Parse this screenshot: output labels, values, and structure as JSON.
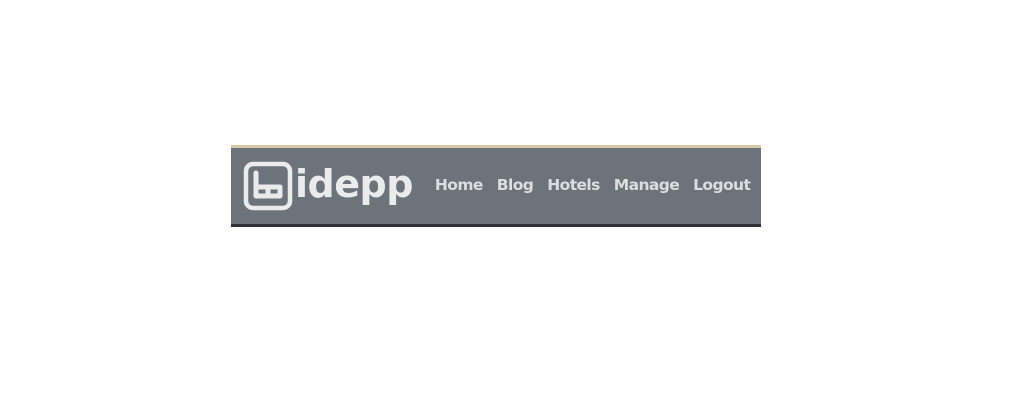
{
  "navbar": {
    "brand": {
      "logo_icon": "w-logo-icon",
      "text": "idepp"
    },
    "links": [
      {
        "label": "Home"
      },
      {
        "label": "Blog"
      },
      {
        "label": "Hotels"
      },
      {
        "label": "Manage"
      },
      {
        "label": "Logout"
      }
    ]
  },
  "colors": {
    "navbar_background": "#6c737b",
    "navbar_top_border": "#d9c8a5",
    "navbar_bottom_border": "#2f3236",
    "logo_and_brand": "#ebebeb",
    "link_text": "#dcdde0"
  }
}
